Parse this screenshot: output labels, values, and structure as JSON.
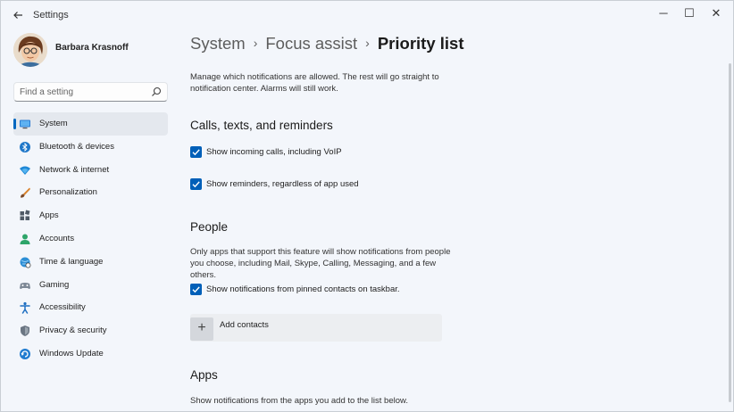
{
  "window": {
    "title": "Settings",
    "back_icon": "back-arrow-icon",
    "controls": {
      "minimize": "─",
      "maximize": "☐",
      "close": "✕"
    }
  },
  "profile": {
    "name": "Barbara Krasnoff"
  },
  "search": {
    "placeholder": "Find a setting",
    "value": ""
  },
  "sidebar": {
    "accent_color": "#0067c0",
    "items": [
      {
        "label": "System",
        "icon": "system-icon",
        "selected": true
      },
      {
        "label": "Bluetooth & devices",
        "icon": "bluetooth-icon"
      },
      {
        "label": "Network & internet",
        "icon": "network-icon"
      },
      {
        "label": "Personalization",
        "icon": "personalization-icon"
      },
      {
        "label": "Apps",
        "icon": "apps-icon"
      },
      {
        "label": "Accounts",
        "icon": "accounts-icon"
      },
      {
        "label": "Time & language",
        "icon": "time-language-icon"
      },
      {
        "label": "Gaming",
        "icon": "gaming-icon"
      },
      {
        "label": "Accessibility",
        "icon": "accessibility-icon"
      },
      {
        "label": "Privacy & security",
        "icon": "privacy-icon"
      },
      {
        "label": "Windows Update",
        "icon": "windows-update-icon"
      }
    ]
  },
  "breadcrumb": {
    "items": [
      "System",
      "Focus assist"
    ],
    "current": "Priority list",
    "separator": "›"
  },
  "main": {
    "intro_line1": "Manage which notifications are allowed. The rest will go straight to",
    "intro_line2": "notification center. Alarms will still work.",
    "calls_section": {
      "title": "Calls, texts, and reminders",
      "options": [
        {
          "label": "Show incoming calls, including VoIP",
          "checked": true
        },
        {
          "label": "Show reminders, regardless of app used",
          "checked": true
        }
      ]
    },
    "people_section": {
      "title": "People",
      "desc_line1": "Only apps that support this feature will show notifications from people",
      "desc_line2": "you choose, including Mail, Skype, Calling, Messaging, and a few others.",
      "option": {
        "label": "Show notifications from pinned contacts on taskbar.",
        "checked": true
      },
      "add_button": "+",
      "add_label": "Add contacts"
    },
    "apps_section": {
      "title": "Apps",
      "desc": "Show notifications from the apps you add to the list below."
    }
  },
  "colors": {
    "checkbox": "#005fb8",
    "background": "#f3f6fb"
  }
}
